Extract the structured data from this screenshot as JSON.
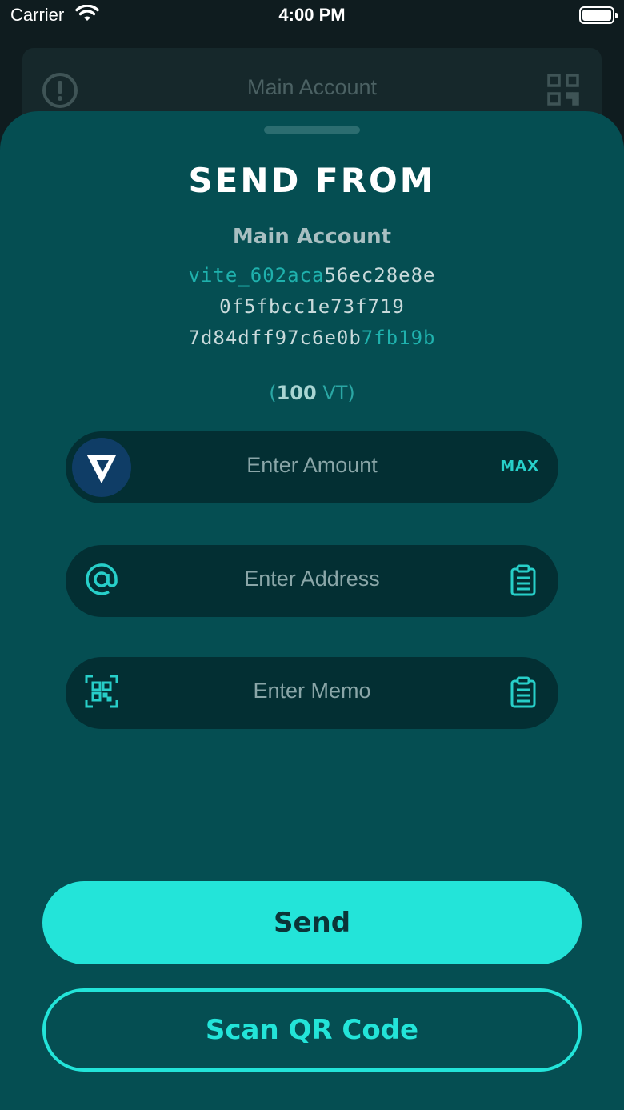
{
  "status_bar": {
    "carrier": "Carrier",
    "time": "4:00 PM"
  },
  "background_header": {
    "title": "Main Account",
    "left_icon": "info-icon",
    "right_icon": "qr-code-icon"
  },
  "sheet": {
    "title": "SEND FROM",
    "account_name": "Main Account",
    "address": {
      "line1_highlight": "vite_602aca",
      "line1_rest": "56ec28e8e",
      "line2": "0f5fbcc1e73f719",
      "line3_rest": "7d84dff97c6e0b",
      "line3_highlight": "7fb19b"
    },
    "balance": {
      "open": "(",
      "amount": "100",
      "unit": " VT)"
    }
  },
  "fields": {
    "amount": {
      "placeholder": "Enter Amount",
      "max_label": "MAX",
      "icon": "vite-logo-icon"
    },
    "address": {
      "placeholder": "Enter Address",
      "icon": "at-sign-icon",
      "action_icon": "clipboard-icon"
    },
    "memo": {
      "placeholder": "Enter Memo",
      "icon": "qr-scan-icon",
      "action_icon": "clipboard-icon"
    }
  },
  "buttons": {
    "send": "Send",
    "scan": "Scan QR Code"
  },
  "colors": {
    "accent": "#23e4d9",
    "sheet": "#054e52",
    "field": "#032f33"
  }
}
